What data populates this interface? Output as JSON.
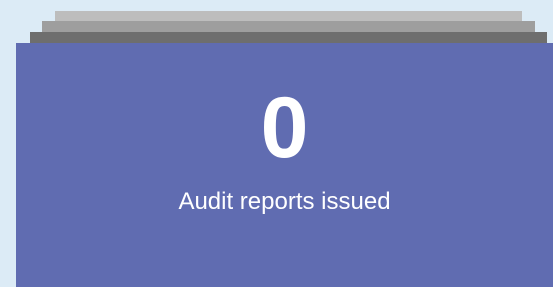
{
  "stat": {
    "value": "0",
    "label": "Audit reports issued"
  },
  "colors": {
    "background": "#dcebf6",
    "card": "#606cb1",
    "stack_back": "#bdbdbd",
    "stack_mid": "#9e9e9e",
    "stack_front": "#6e6e6e",
    "text": "#ffffff"
  }
}
